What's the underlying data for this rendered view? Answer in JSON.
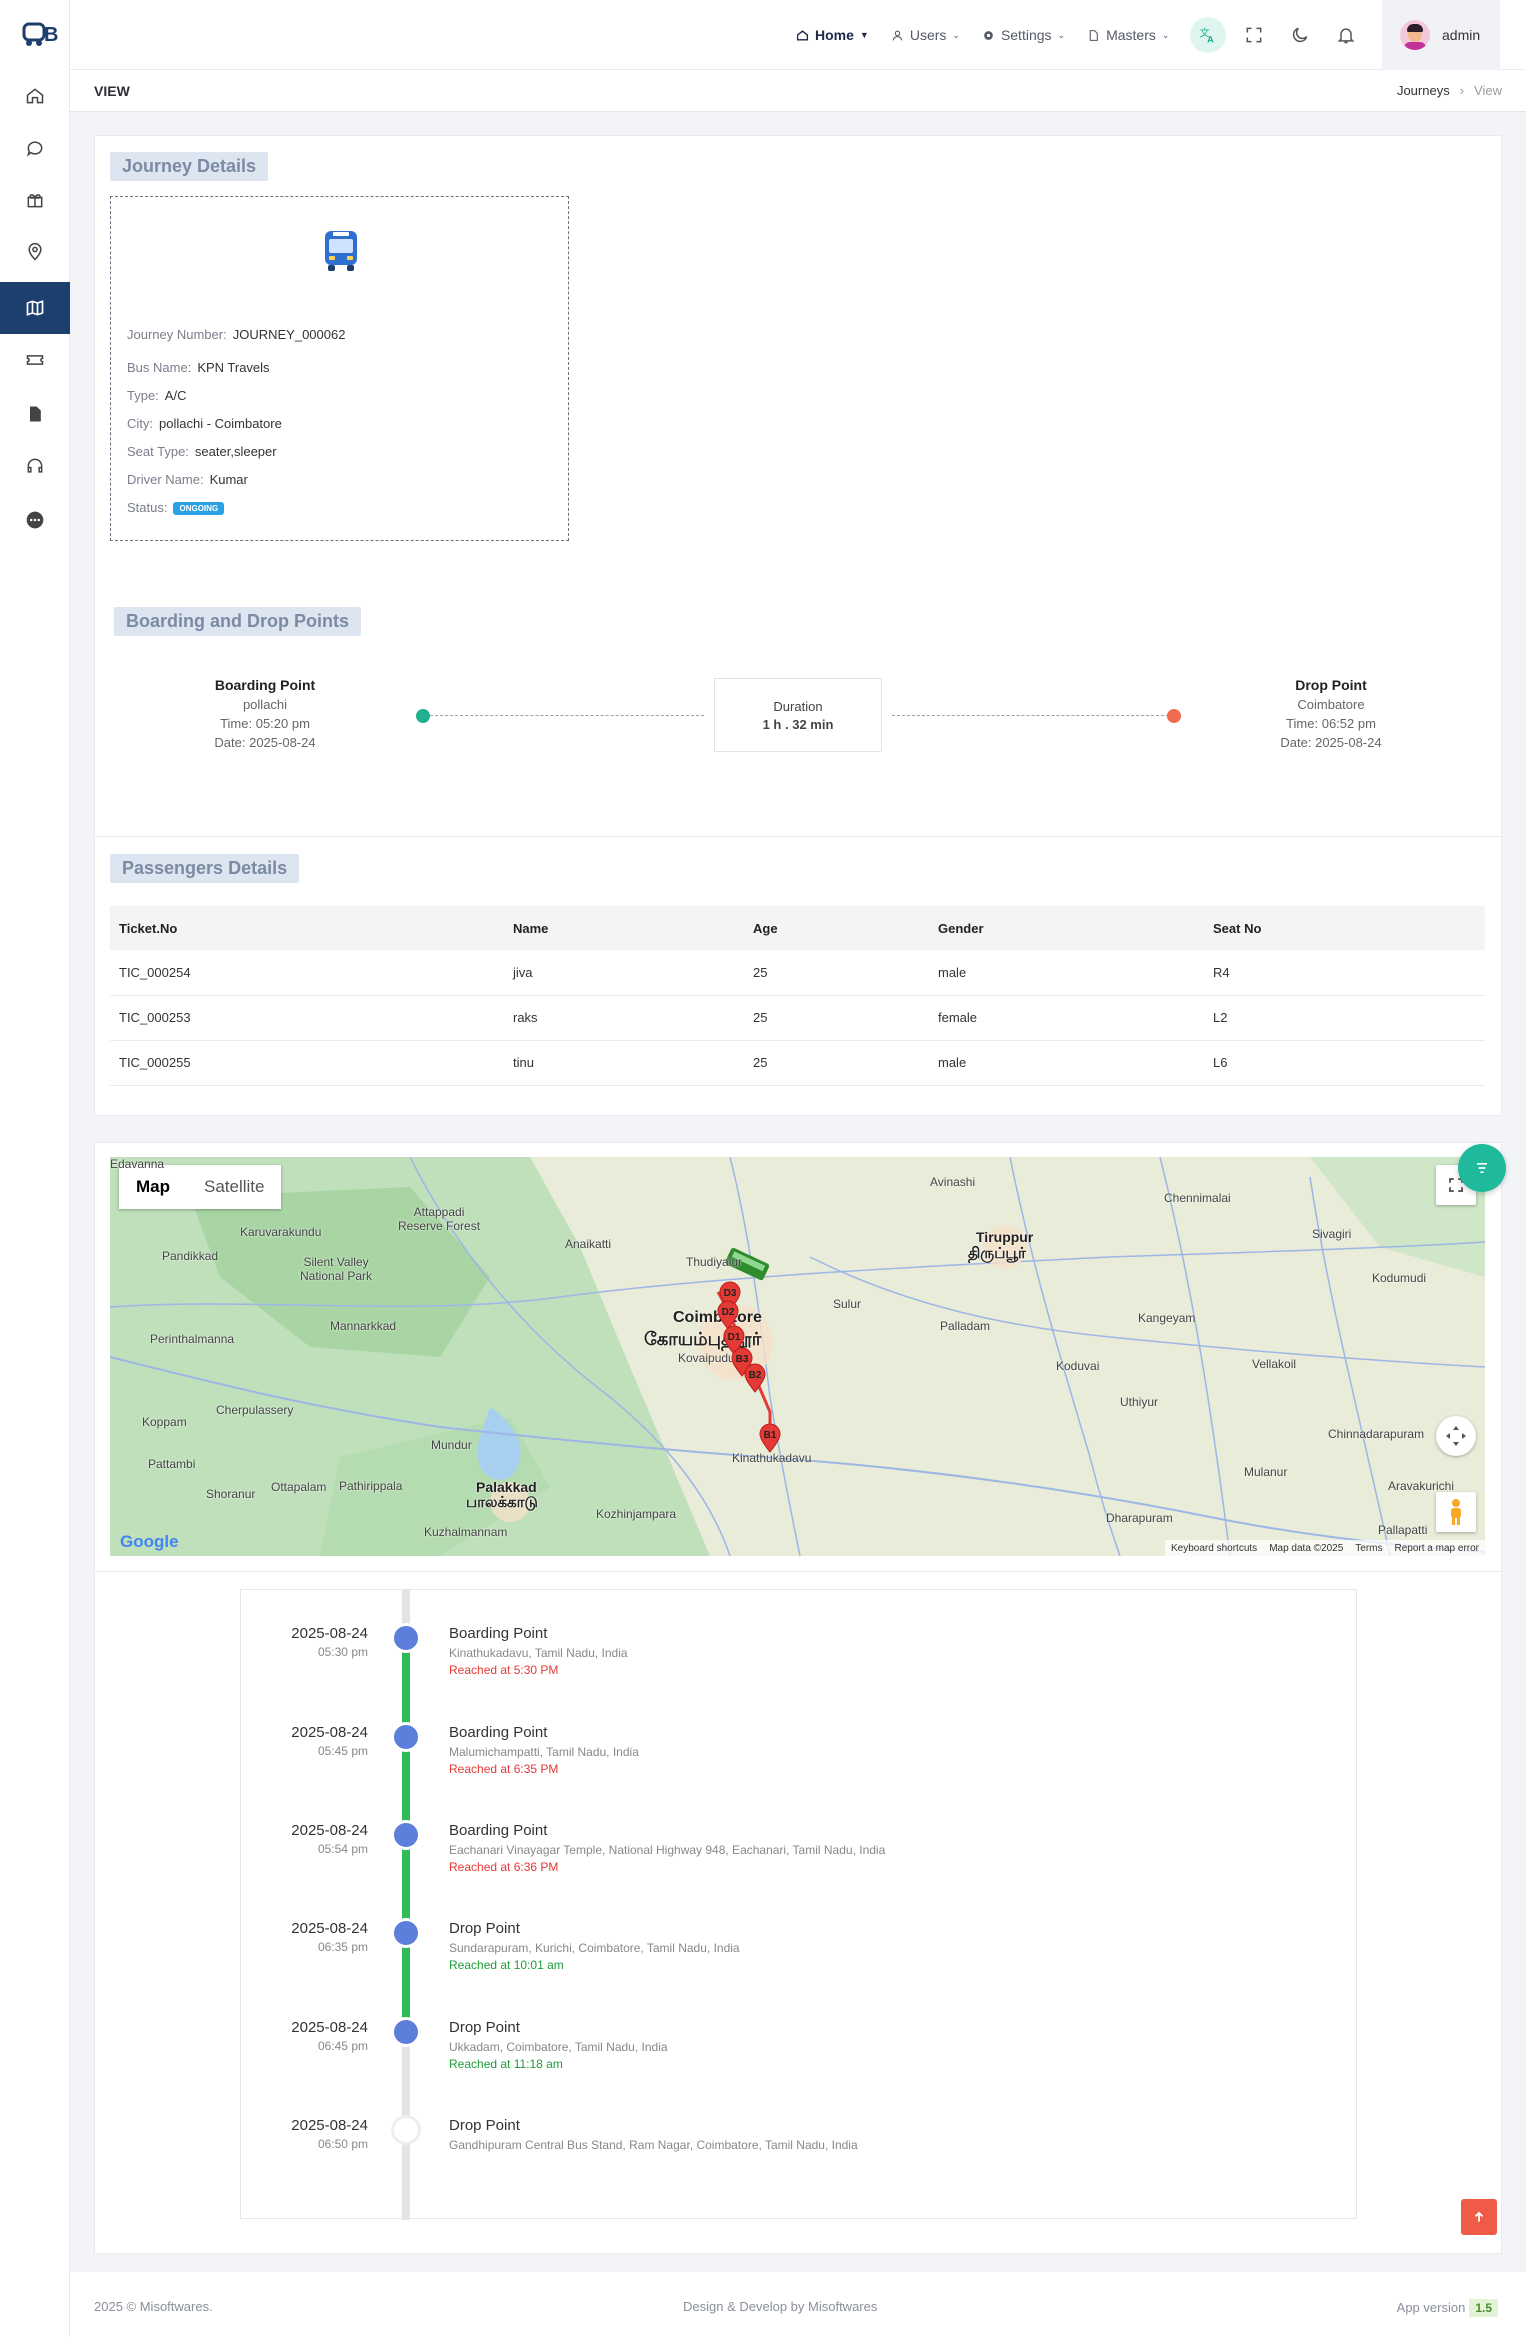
{
  "app": {
    "logo_text": "BB"
  },
  "sidebar": {
    "items": [
      {
        "name": "home-icon"
      },
      {
        "name": "chat-icon"
      },
      {
        "name": "gift-icon"
      },
      {
        "name": "location-icon"
      },
      {
        "name": "map-icon",
        "active": true
      },
      {
        "name": "ticket-icon"
      },
      {
        "name": "document-icon"
      },
      {
        "name": "headset-icon"
      },
      {
        "name": "more-icon"
      }
    ]
  },
  "topbar": {
    "nav": [
      {
        "label": "Home",
        "icon": "home-icon"
      },
      {
        "label": "Users",
        "icon": "user-icon"
      },
      {
        "label": "Settings",
        "icon": "gear-icon"
      },
      {
        "label": "Masters",
        "icon": "document-icon"
      }
    ],
    "user": {
      "name": "admin"
    }
  },
  "page": {
    "title": "VIEW",
    "breadcrumb": [
      "Journeys",
      "View"
    ]
  },
  "journey": {
    "section_title": "Journey Details",
    "rows": [
      {
        "label": "Journey Number:",
        "value": "JOURNEY_000062"
      },
      {
        "label": "Bus Name:",
        "value": "KPN Travels"
      },
      {
        "label": "Type:",
        "value": "A/C"
      },
      {
        "label": "City:",
        "value": "pollachi - Coimbatore"
      },
      {
        "label": "Seat Type:",
        "value": "seater,sleeper"
      },
      {
        "label": "Driver Name:",
        "value": "Kumar"
      }
    ],
    "status_label": "Status:",
    "status": "ONGOING"
  },
  "points": {
    "section_title": "Boarding and Drop Points",
    "boarding": {
      "title": "Boarding Point",
      "place": "pollachi",
      "time": "Time: 05:20 pm",
      "date": "Date: 2025-08-24"
    },
    "drop": {
      "title": "Drop Point",
      "place": "Coimbatore",
      "time": "Time: 06:52 pm",
      "date": "Date: 2025-08-24"
    },
    "duration": {
      "label": "Duration",
      "value": "1 h . 32 min"
    }
  },
  "passengers": {
    "section_title": "Passengers Details",
    "columns": [
      "Ticket.No",
      "Name",
      "Age",
      "Gender",
      "Seat No"
    ],
    "rows": [
      [
        "TIC_000254",
        "jiva",
        "25",
        "male",
        "R4"
      ],
      [
        "TIC_000253",
        "raks",
        "25",
        "female",
        "L2"
      ],
      [
        "TIC_000255",
        "tinu",
        "25",
        "male",
        "L6"
      ]
    ]
  },
  "map": {
    "tabs": [
      "Map",
      "Satellite"
    ],
    "labels": {
      "coimbatore": "Coimbatore",
      "coimbatore_ta": "கோயம்புத்தூர்",
      "tiruppur": "Tiruppur",
      "tiruppur_ta": "திருப்பூர்",
      "palakkad": "Palakkad",
      "palakkad_ta": "பாலக்காடு",
      "silent_valley": "Silent Valley\nNational Park",
      "attappadi": "Attappadi\nReserve Forest",
      "anaikatti": "Anaikatti",
      "pandikkad": "Pandikkad",
      "mannarkkad": "Mannarkkad",
      "perinthalmanna": "Perinthalmanna",
      "cherpulassery": "Cherpulassery",
      "koppam": "Koppam",
      "pattambi": "Pattambi",
      "shoranur": "Shoranur",
      "ottapalam": "Ottapalam",
      "pathirippala": "Pathirippala",
      "mundur": "Mundur",
      "kozhinjampara": "Kozhinjampara",
      "kuzhalmannam": "Kuzhalmannam",
      "kinathukadavu": "Kinathukadavu",
      "sulur": "Sulur",
      "palladam": "Palladam",
      "koduvai": "Koduvai",
      "kangeyam": "Kangeyam",
      "uthiyur": "Uthiyur",
      "vellakoil": "Vellakoil",
      "dharapuram": "Dharapuram",
      "avinashi": "Avinashi",
      "chennimalai": "Chennimalai",
      "sivagiri": "Sivagiri",
      "kodumudi": "Kodumudi",
      "mulanur": "Mulanur",
      "chinnadarapuram": "Chinnadarapuram",
      "aravakurichi": "Aravakurichi",
      "pallapatti": "Pallapatti",
      "kovaipudur": "Kovaipudur",
      "thudiyalur": "Thudiyalur",
      "edavanna": "Edavanna",
      "karuvarakundu": "Karuvarakundu"
    },
    "markers": [
      "D3",
      "D2",
      "D1",
      "B3",
      "B2",
      "B1"
    ],
    "footer": [
      "Keyboard shortcuts",
      "Map data ©2025",
      "Terms",
      "Report a map error"
    ],
    "google": "Google"
  },
  "timeline": [
    {
      "date": "2025-08-24",
      "time": "05:30 pm",
      "title": "Boarding Point",
      "address": "Kinathukadavu, Tamil Nadu, India",
      "status": "Reached at 5:30 PM",
      "color": "#e53935"
    },
    {
      "date": "2025-08-24",
      "time": "05:45 pm",
      "title": "Boarding Point",
      "address": "Malumichampatti, Tamil Nadu, India",
      "status": "Reached at 6:35 PM",
      "color": "#e53935"
    },
    {
      "date": "2025-08-24",
      "time": "05:54 pm",
      "title": "Boarding Point",
      "address": "Eachanari Vinayagar Temple, National Highway 948, Eachanari, Tamil Nadu, India",
      "status": "Reached at 6:36 PM",
      "color": "#e53935"
    },
    {
      "date": "2025-08-24",
      "time": "06:35 pm",
      "title": "Drop Point",
      "address": "Sundarapuram, Kurichi, Coimbatore, Tamil Nadu, India",
      "status": "Reached at 10:01 am",
      "color": "#1e9c3a"
    },
    {
      "date": "2025-08-24",
      "time": "06:45 pm",
      "title": "Drop Point",
      "address": "Ukkadam, Coimbatore, Tamil Nadu, India",
      "status": "Reached at 11:18 am",
      "color": "#1e9c3a"
    },
    {
      "date": "2025-08-24",
      "time": "06:50 pm",
      "title": "Drop Point",
      "address": "Gandhipuram Central Bus Stand, Ram Nagar, Coimbatore, Tamil Nadu, India",
      "status": "",
      "color": "#888"
    }
  ],
  "footer": {
    "left": "2025 © Misoftwares.",
    "center": "Design & Develop by Misoftwares",
    "right": "App version",
    "version": "1.5"
  }
}
